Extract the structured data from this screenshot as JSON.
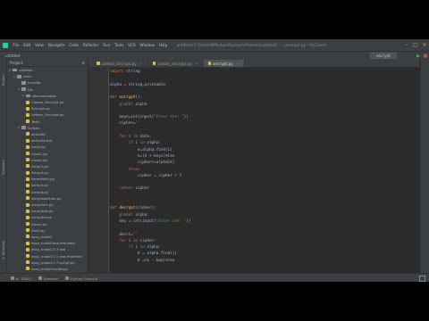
{
  "menubar": {
    "items": [
      "File",
      "Edit",
      "View",
      "Navigate",
      "Code",
      "Refactor",
      "Run",
      "Tools",
      "VCS",
      "Window",
      "Help"
    ],
    "title": "untitled [C:\\Users\\MPhukan\\PycharmProjects\\untitled] - ...\\encrypt.py - PyCharm"
  },
  "navbar": {
    "crumb": "untitled",
    "run_config": "encrypt"
  },
  "sidebar": {
    "project_label": "Project",
    "structure_label": "Structure",
    "favorites_label": "2: Favorites"
  },
  "project_panel": {
    "title": "Project",
    "tree": [
      {
        "label": "untitled",
        "depth": 0,
        "type": "folder",
        "arrow": "▾"
      },
      {
        "label": "venv",
        "depth": 1,
        "type": "folder",
        "arrow": "▾"
      },
      {
        "label": "Include",
        "depth": 2,
        "type": "folder",
        "arrow": ""
      },
      {
        "label": "Lib",
        "depth": 2,
        "type": "folder",
        "arrow": "▾"
      },
      {
        "label": "site-packages",
        "depth": 3,
        "type": "folder",
        "arrow": "▸"
      },
      {
        "label": "Caesar_Encrypt.py",
        "depth": 3,
        "type": "file",
        "arrow": ""
      },
      {
        "label": "Encrypt.py",
        "depth": 3,
        "type": "file",
        "arrow": ""
      },
      {
        "label": "Letters_Encrypt.py",
        "depth": 3,
        "type": "file",
        "arrow": ""
      },
      {
        "label": "Test1",
        "depth": 3,
        "type": "file",
        "arrow": ""
      },
      {
        "label": "Scripts",
        "depth": 2,
        "type": "folder",
        "arrow": "▾"
      },
      {
        "label": "activate",
        "depth": 3,
        "type": "file",
        "arrow": ""
      },
      {
        "label": "activate.bat",
        "depth": 3,
        "type": "file",
        "arrow": ""
      },
      {
        "label": "Array.py",
        "depth": 3,
        "type": "file",
        "arrow": ""
      },
      {
        "label": "class1.py",
        "depth": 3,
        "type": "file",
        "arrow": ""
      },
      {
        "label": "class2.py",
        "depth": 3,
        "type": "file",
        "arrow": ""
      },
      {
        "label": "Array3.py",
        "depth": 3,
        "type": "file",
        "arrow": ""
      },
      {
        "label": "Array4.py",
        "depth": 3,
        "type": "file",
        "arrow": ""
      },
      {
        "label": "ArrayMulti.py",
        "depth": 3,
        "type": "file",
        "arrow": ""
      },
      {
        "label": "Array5.py",
        "depth": 3,
        "type": "file",
        "arrow": ""
      },
      {
        "label": "Array6.py",
        "depth": 3,
        "type": "file",
        "arrow": ""
      },
      {
        "label": "ArrayInsertion.py",
        "depth": 3,
        "type": "file",
        "arrow": ""
      },
      {
        "label": "ArraySort.py",
        "depth": 3,
        "type": "file",
        "arrow": ""
      },
      {
        "label": "ArrayUpd.py",
        "depth": 3,
        "type": "file",
        "arrow": ""
      },
      {
        "label": "ArrayDel.py",
        "depth": 3,
        "type": "file",
        "arrow": ""
      },
      {
        "label": "Deact.py",
        "depth": 3,
        "type": "file",
        "arrow": ""
      },
      {
        "label": "Shell.py",
        "depth": 3,
        "type": "file",
        "arrow": ""
      },
      {
        "label": "easy_install",
        "depth": 3,
        "type": "file",
        "arrow": ""
      },
      {
        "label": "easy_install.exe.manifest",
        "depth": 3,
        "type": "file",
        "arrow": ""
      },
      {
        "label": "easy_install-3.7.exe",
        "depth": 3,
        "type": "file",
        "arrow": ""
      },
      {
        "label": "easy_install-3.7.exe.manifest",
        "depth": 3,
        "type": "file",
        "arrow": ""
      },
      {
        "label": "easy_install-3.7-script.py",
        "depth": 3,
        "type": "file",
        "arrow": ""
      },
      {
        "label": "easy_install-script.py",
        "depth": 3,
        "type": "file",
        "arrow": ""
      },
      {
        "label": "encrypt.py",
        "depth": 3,
        "type": "file",
        "arrow": ""
      }
    ]
  },
  "tabs": [
    {
      "label": "Letters_Encrypt.py",
      "active": false
    },
    {
      "label": "caesar_encrypt.py",
      "active": false
    },
    {
      "label": "encrypt.py",
      "active": true
    }
  ],
  "code_lines": [
    [
      {
        "t": "import ",
        "c": "kw"
      },
      {
        "t": "string",
        "c": ""
      }
    ],
    [],
    [
      {
        "t": "alpha = string.printable",
        "c": ""
      }
    ],
    [],
    [
      {
        "t": "def ",
        "c": "kw"
      },
      {
        "t": "encrypt",
        "c": "fn"
      },
      {
        "t": "():",
        "c": ""
      }
    ],
    [
      {
        "t": "    ",
        "c": ""
      },
      {
        "t": "global ",
        "c": "kw"
      },
      {
        "t": "alpha",
        "c": ""
      }
    ],
    [],
    [
      {
        "t": "    keys=int(input(",
        "c": ""
      },
      {
        "t": "\"Enter the: \"",
        "c": "str"
      },
      {
        "t": "))",
        "c": ""
      }
    ],
    [
      {
        "t": "    cipher=''",
        "c": ""
      }
    ],
    [],
    [
      {
        "t": "    ",
        "c": ""
      },
      {
        "t": "for ",
        "c": "kw"
      },
      {
        "t": "i ",
        "c": ""
      },
      {
        "t": "in ",
        "c": "kw"
      },
      {
        "t": "data:",
        "c": ""
      }
    ],
    [
      {
        "t": "        ",
        "c": ""
      },
      {
        "t": "if ",
        "c": "kw"
      },
      {
        "t": "i ",
        "c": ""
      },
      {
        "t": "in ",
        "c": "kw"
      },
      {
        "t": "alpha:",
        "c": ""
      }
    ],
    [
      {
        "t": "            k=alpha.find(i)",
        "c": ""
      }
    ],
    [
      {
        "t": "            k=(k + keys)%len",
        "c": ""
      }
    ],
    [
      {
        "t": "            cipher+=alpha[k]",
        "c": ""
      }
    ],
    [
      {
        "t": "        ",
        "c": ""
      },
      {
        "t": "else",
        "c": "kw"
      },
      {
        "t": ":",
        "c": ""
      }
    ],
    [
      {
        "t": "            cipher = cipher + i",
        "c": ""
      }
    ],
    [],
    [
      {
        "t": "    ",
        "c": ""
      },
      {
        "t": "return ",
        "c": "kw"
      },
      {
        "t": "cipher",
        "c": ""
      }
    ],
    [],
    [],
    [
      {
        "t": "def ",
        "c": "kw"
      },
      {
        "t": "decrypt",
        "c": "fn"
      },
      {
        "t": "(cipher):",
        "c": ""
      }
    ],
    [
      {
        "t": "    ",
        "c": ""
      },
      {
        "t": "global ",
        "c": "kw"
      },
      {
        "t": "alpha",
        "c": ""
      }
    ],
    [
      {
        "t": "    key = int(input(",
        "c": ""
      },
      {
        "t": "\"Enter the: \"",
        "c": "str"
      },
      {
        "t": "))",
        "c": ""
      }
    ],
    [],
    [
      {
        "t": "    decrt=''",
        "c": ""
      }
    ],
    [
      {
        "t": "    ",
        "c": ""
      },
      {
        "t": "for ",
        "c": "kw"
      },
      {
        "t": "i ",
        "c": ""
      },
      {
        "t": "in ",
        "c": "kw"
      },
      {
        "t": "cipher:",
        "c": ""
      }
    ],
    [
      {
        "t": "        ",
        "c": ""
      },
      {
        "t": "if ",
        "c": "kw"
      },
      {
        "t": "i ",
        "c": ""
      },
      {
        "t": "in ",
        "c": "kw"
      },
      {
        "t": "alpha:",
        "c": ""
      }
    ],
    [
      {
        "t": "            k = alpha.find(i)",
        "c": ""
      }
    ],
    [
      {
        "t": "            k =(k - key)%len",
        "c": ""
      }
    ]
  ],
  "statusbar": {
    "todo": "6: TODO",
    "terminal": "Terminal",
    "console": "Python Console"
  },
  "colors": {
    "keyword": "#cc7832",
    "function": "#ffc66d",
    "string": "#6a8759"
  }
}
